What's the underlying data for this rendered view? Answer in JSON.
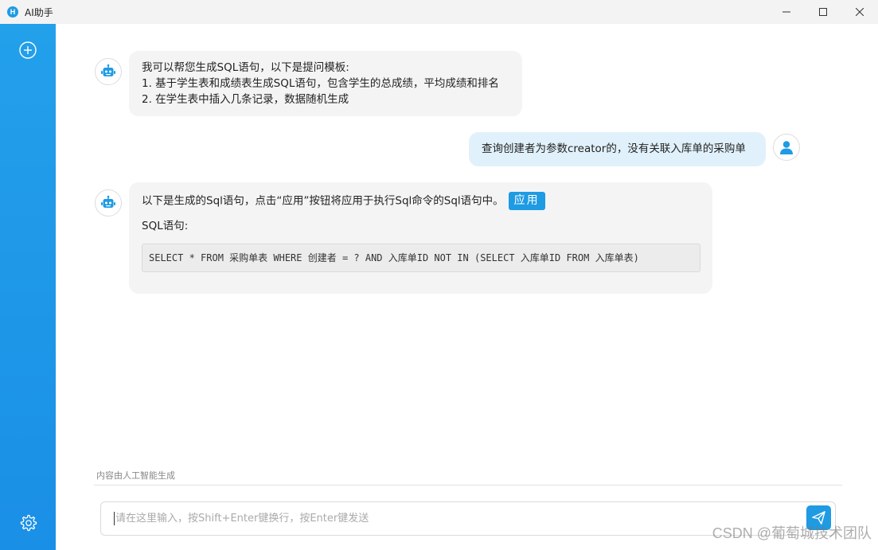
{
  "window": {
    "title": "AI助手",
    "icon_letter": "H",
    "controls": [
      "minimize-icon",
      "maximize-icon",
      "close-icon"
    ]
  },
  "sidebar": {
    "new_chat_icon": "plus-circle-icon",
    "settings_icon": "gear-icon"
  },
  "messages": [
    {
      "role": "assistant",
      "avatar_icon": "robot-icon",
      "lines": [
        "我可以帮您生成SQL语句，以下是提问模板:",
        "1. 基于学生表和成绩表生成SQL语句，包含学生的总成绩，平均成绩和排名",
        "2. 在学生表中插入几条记录，数据随机生成"
      ]
    },
    {
      "role": "user",
      "avatar_icon": "user-icon",
      "text": "查询创建者为参数creator的，没有关联入库单的采购单"
    },
    {
      "role": "assistant",
      "avatar_icon": "robot-icon",
      "intro": "以下是生成的Sql语句，点击“应用”按钮将应用于执行Sql命令的Sql语句中。",
      "apply_label": "应用",
      "sql_label": "SQL语句:",
      "sql": "SELECT * FROM 采购单表 WHERE 创建者 = ? AND 入库单ID NOT IN (SELECT 入库单ID FROM 入库单表)"
    }
  ],
  "footer": {
    "disclaimer": "内容由人工智能生成",
    "input_value": "",
    "input_placeholder": "请在这里输入，按Shift+Enter键换行，按Enter键发送",
    "send_icon": "send-icon",
    "watermark": "CSDN @葡萄城技术团队"
  },
  "colors": {
    "accent": "#1e9be3",
    "bot_bubble": "#f4f4f4",
    "user_bubble": "#e1f1fb"
  }
}
